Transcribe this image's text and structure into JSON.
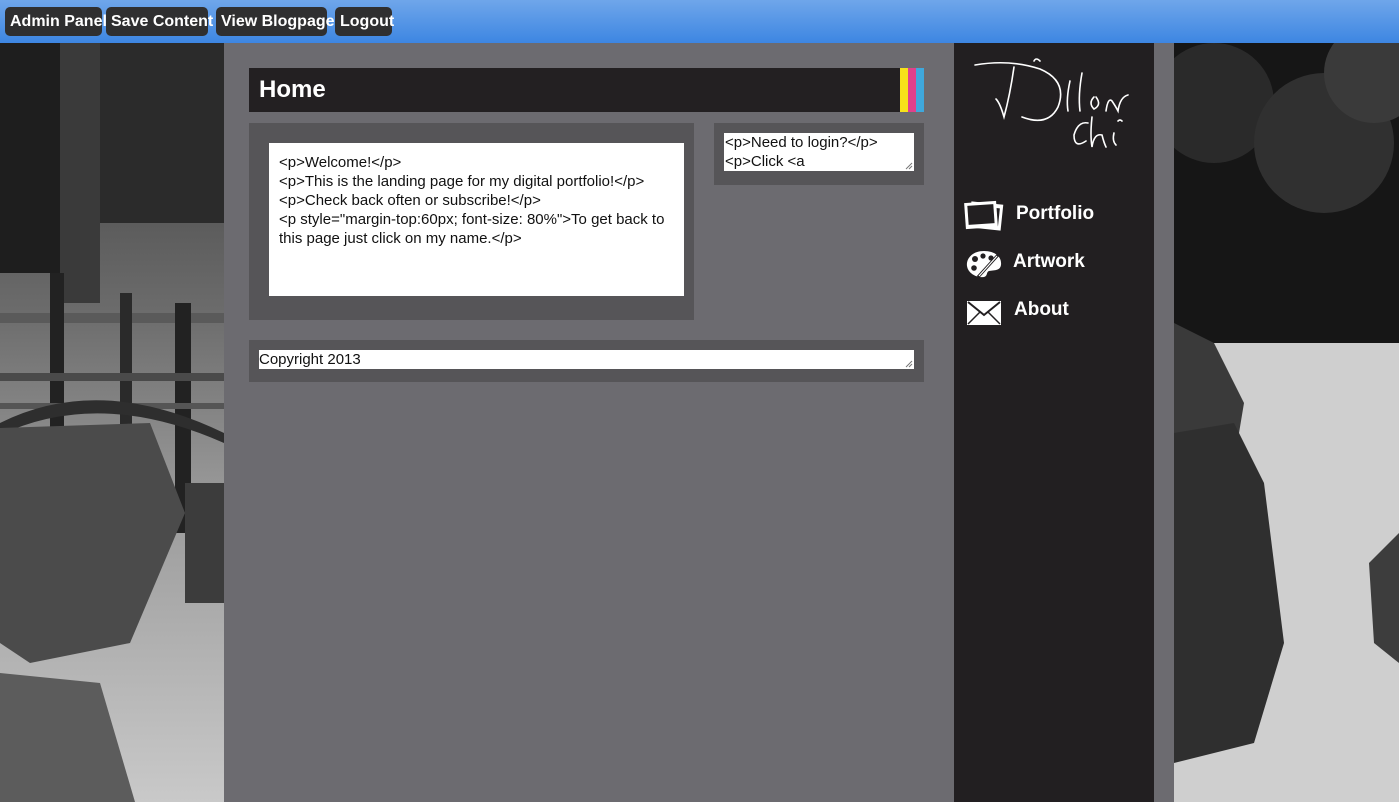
{
  "admin_bar": {
    "buttons": [
      "Admin Panel",
      "Save Content",
      "View Blogpage",
      "Logout"
    ]
  },
  "page": {
    "title": "Home",
    "stripe_colors": [
      "#f7e21a",
      "#e0418b",
      "#3fa8dc"
    ]
  },
  "content": {
    "main_editor": "<p>Welcome!</p>\n<p>This is the landing page for my digital portfolio!</p>\n<p>Check back often or subscribe!</p>\n<p style=\"margin-top:60px; font-size: 80%\">To get back to this page just click on my name.</p>",
    "side_editor": "<p>Need to login?</p>\n<p>Click <a",
    "footer_editor": "Copyright 2013"
  },
  "sidebar": {
    "logo_icon": "signature-logo",
    "nav": [
      {
        "label": "Portfolio",
        "icon": "photos-icon"
      },
      {
        "label": "Artwork",
        "icon": "palette-icon"
      },
      {
        "label": "About",
        "icon": "envelope-icon"
      }
    ]
  },
  "colors": {
    "admin_bar": "#4a90e6",
    "page_bg": "#6c6b70",
    "panel_bg": "#565558",
    "sidebar_bg": "#221f21"
  }
}
